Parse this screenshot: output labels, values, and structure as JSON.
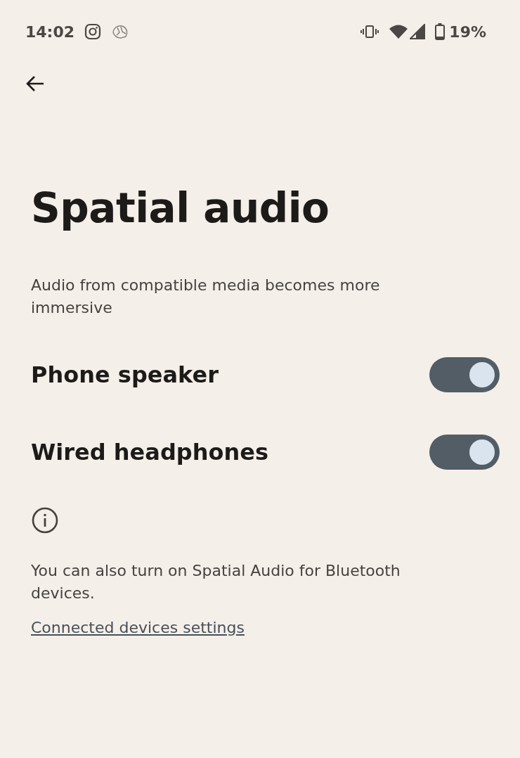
{
  "status_bar": {
    "time": "14:02",
    "battery": "19%"
  },
  "title": "Spatial audio",
  "description": "Audio from compatible media becomes more immersive",
  "settings": [
    {
      "label": "Phone speaker",
      "on": true
    },
    {
      "label": "Wired headphones",
      "on": true
    }
  ],
  "footer": {
    "text": "You can also turn on Spatial Audio for Bluetooth devices.",
    "link": "Connected devices settings"
  }
}
